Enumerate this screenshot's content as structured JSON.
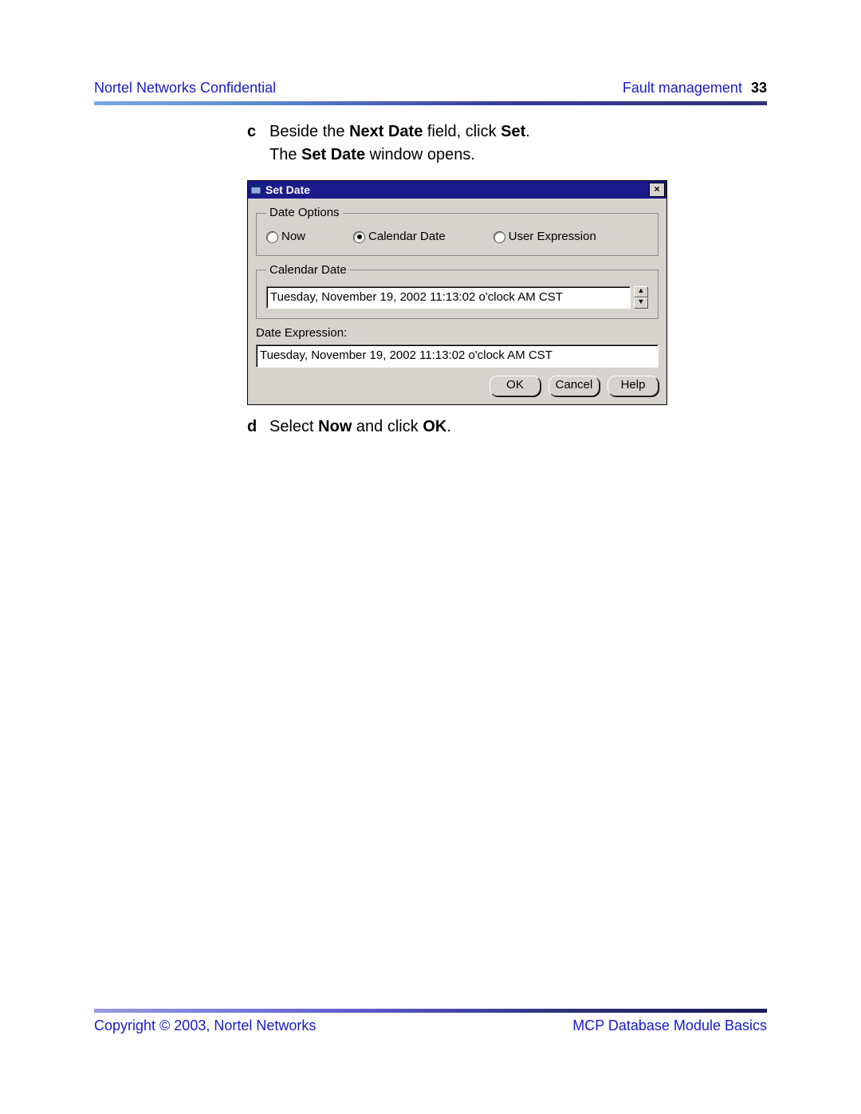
{
  "header": {
    "left": "Nortel Networks Confidential",
    "right_section": "Fault management",
    "page_number": "33"
  },
  "steps": {
    "c": {
      "letter": "c",
      "line1_pre": "Beside the ",
      "line1_bold1": "Next Date",
      "line1_mid": " field, click ",
      "line1_bold2": "Set",
      "line1_post": ".",
      "line2_pre": "The ",
      "line2_bold": "Set Date",
      "line2_post": " window opens."
    },
    "d": {
      "letter": "d",
      "pre": "Select ",
      "bold1": "Now",
      "mid": " and click ",
      "bold2": "OK",
      "post": "."
    }
  },
  "window": {
    "title": "Set Date",
    "close_glyph": "×",
    "date_options_legend": "Date Options",
    "radios": {
      "now": "Now",
      "calendar": "Calendar Date",
      "user_expr": "User Expression"
    },
    "calendar_legend": "Calendar Date",
    "calendar_value": "Tuesday, November 19, 2002 11:13:02 o'clock AM CST",
    "spin_up": "▲",
    "spin_down": "▼",
    "expr_label": "Date Expression:",
    "expr_value": "Tuesday, November 19, 2002 11:13:02 o'clock AM CST",
    "buttons": {
      "ok": "OK",
      "cancel": "Cancel",
      "help": "Help"
    }
  },
  "footer": {
    "left": "Copyright © 2003, Nortel Networks",
    "right": "MCP Database Module Basics"
  }
}
